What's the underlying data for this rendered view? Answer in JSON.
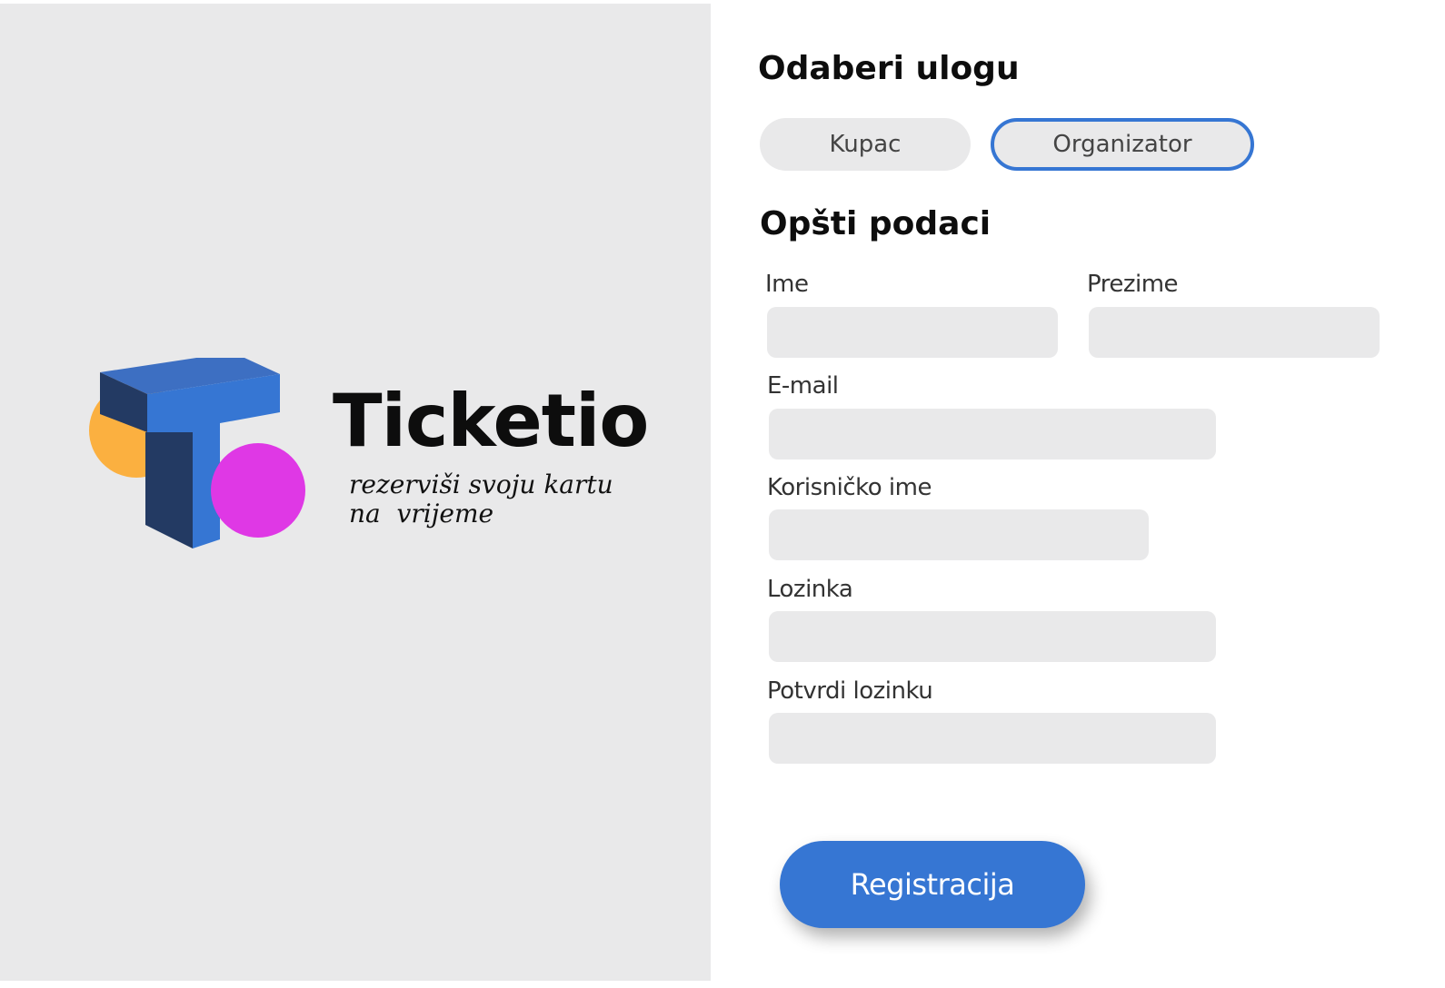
{
  "brand": {
    "name": "Ticketio",
    "tagline_line1": "rezerviši svoju kartu",
    "tagline_line2": "na  vrijeme"
  },
  "role_section": {
    "title": "Odaberi ulogu",
    "options": [
      {
        "label": "Kupac",
        "selected": false
      },
      {
        "label": "Organizator",
        "selected": true
      }
    ]
  },
  "general_section": {
    "title": "Opšti podaci",
    "fields": {
      "first_name": {
        "label": "Ime",
        "value": ""
      },
      "last_name": {
        "label": "Prezime",
        "value": ""
      },
      "email": {
        "label": "E-mail",
        "value": ""
      },
      "username": {
        "label": "Korisničko ime",
        "value": ""
      },
      "password": {
        "label": "Lozinka",
        "value": ""
      },
      "confirm_password": {
        "label": "Potvrdi lozinku",
        "value": ""
      }
    }
  },
  "submit": {
    "label": "Registracija"
  },
  "colors": {
    "accent": "#3676d3",
    "panel_bg": "#e9e9ea",
    "logo_orange": "#fbb040",
    "logo_magenta": "#df38e5",
    "logo_navy": "#233a63",
    "logo_blue": "#3676d3"
  }
}
